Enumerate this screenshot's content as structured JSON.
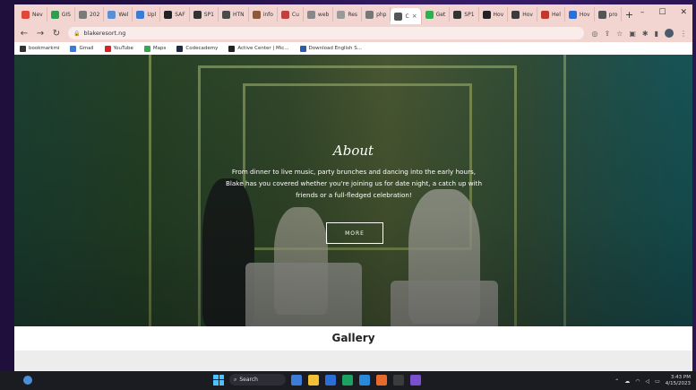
{
  "browser": {
    "tabs": [
      {
        "label": "Nev",
        "color": "#e0463a"
      },
      {
        "label": "GIS",
        "color": "#2e9e4f"
      },
      {
        "label": "202",
        "color": "#7a7a7a"
      },
      {
        "label": "Wel",
        "color": "#5a8fd6"
      },
      {
        "label": "Upl",
        "color": "#3a7bd5"
      },
      {
        "label": "SAF",
        "color": "#222222"
      },
      {
        "label": "SP1",
        "color": "#333333"
      },
      {
        "label": "HTN",
        "color": "#4a4a4a"
      },
      {
        "label": "info",
        "color": "#8a5a3a"
      },
      {
        "label": "Cu",
        "color": "#c04040"
      },
      {
        "label": "web",
        "color": "#888888"
      },
      {
        "label": "Res",
        "color": "#999999"
      },
      {
        "label": "php",
        "color": "#777777"
      },
      {
        "label": "C",
        "color": "#555555",
        "active": true
      },
      {
        "label": "Get",
        "color": "#2bb24c"
      },
      {
        "label": "SP1",
        "color": "#333333"
      },
      {
        "label": "Hov",
        "color": "#222222"
      },
      {
        "label": "Hov",
        "color": "#3b3b3b"
      },
      {
        "label": "Hel",
        "color": "#c0392b"
      },
      {
        "label": "Hov",
        "color": "#2a6fdb"
      },
      {
        "label": "pro",
        "color": "#555555"
      }
    ],
    "new_tab": "+",
    "win_min": "–",
    "win_max": "☐",
    "win_close": "✕",
    "nav_back": "←",
    "nav_forward": "→",
    "nav_reload": "↻",
    "url": "blakeresort.ng",
    "bookmarks": [
      {
        "label": "bookmarkmi",
        "color": "#333333"
      },
      {
        "label": "Gmail",
        "color": "#3a7bd5"
      },
      {
        "label": "YouTube",
        "color": "#e02020"
      },
      {
        "label": "Maps",
        "color": "#34a853"
      },
      {
        "label": "Codecademy",
        "color": "#1f2a44"
      },
      {
        "label": "Active Center | Mic...",
        "color": "#222222"
      },
      {
        "label": "Download English S...",
        "color": "#2a5db0"
      }
    ]
  },
  "hero": {
    "title": "About",
    "text": "From dinner to live music, party brunches and dancing into the early hours, Blake has you covered whether you're joining us for date night, a catch up with friends or a full-fledged celebration!",
    "button": "MORE"
  },
  "gallery": {
    "title": "Gallery"
  },
  "taskbar": {
    "search": "Search",
    "time": "3:43 PM",
    "date": "4/15/2023",
    "app_colors": [
      "#3b7dd8",
      "#f2c037",
      "#2b6fd6",
      "#1aa260",
      "#2a89d8",
      "#e66a2c",
      "#3b3b3b",
      "#7a4fd0"
    ]
  }
}
